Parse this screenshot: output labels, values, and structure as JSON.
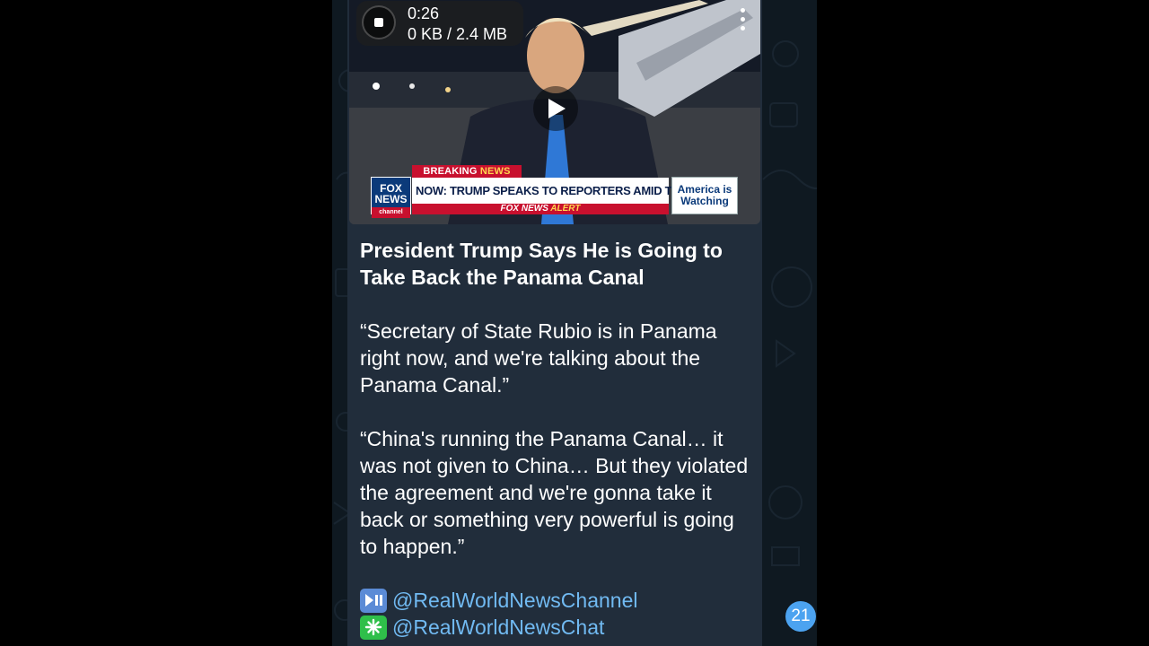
{
  "video": {
    "elapsed": "0:26",
    "download_progress": "0 KB / 2.4 MB",
    "chyron": {
      "tag_part1": "BREAKING",
      "tag_part2": "NEWS",
      "network_logo": "FOX NEWS",
      "network_logo_sub": "channel",
      "headline": "NOW: TRUMP SPEAKS TO REPORTERS AMID TRADE WAR",
      "alert_part1": "FOX NEWS",
      "alert_part2": "ALERT",
      "side_box_line1": "America is",
      "side_box_line2": "Watching"
    }
  },
  "post": {
    "title": "President Trump Says He is Going to Take Back the Panama Canal",
    "quote1": "“Secretary of State Rubio is in Panama right now, and we're talking about the Panama Canal.”",
    "quote2": "“China's running the Panama Canal… it was not given to China… But they violated the agreement and we're gonna take it back or something very powerful is going to happen.”",
    "links": [
      {
        "icon": "play-pause-emoji",
        "text": "@RealWorldNewsChannel"
      },
      {
        "icon": "sparkle-emoji",
        "text": "@RealWorldNewsChat"
      }
    ]
  },
  "unread_count": "21",
  "colors": {
    "bubble": "#212d3b",
    "background": "#0f1921",
    "link": "#71baf2",
    "badge": "#4ca3f0",
    "breaking_red": "#c8102e"
  }
}
